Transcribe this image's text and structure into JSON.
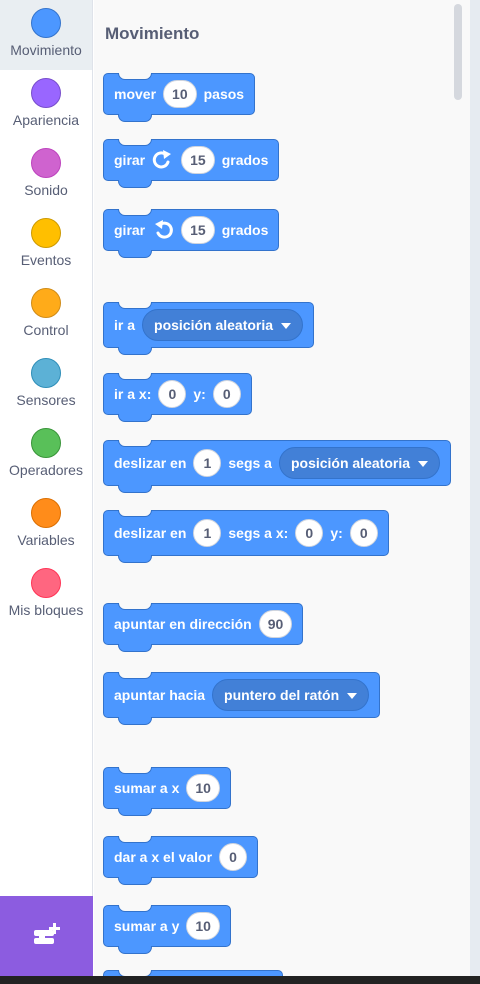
{
  "sidebar": {
    "items": [
      {
        "label": "Movimiento",
        "color": "#4c97ff",
        "border": "#3373cc"
      },
      {
        "label": "Apariencia",
        "color": "#9966ff",
        "border": "#774dcb"
      },
      {
        "label": "Sonido",
        "color": "#cf63cf",
        "border": "#bd42bd"
      },
      {
        "label": "Eventos",
        "color": "#ffbf00",
        "border": "#cc9900"
      },
      {
        "label": "Control",
        "color": "#ffab19",
        "border": "#cf8b17"
      },
      {
        "label": "Sensores",
        "color": "#5cb1d6",
        "border": "#2e8eb8"
      },
      {
        "label": "Operadores",
        "color": "#59c059",
        "border": "#389438"
      },
      {
        "label": "Variables",
        "color": "#ff8c1a",
        "border": "#db6e00"
      },
      {
        "label": "Mis bloques",
        "color": "#ff6680",
        "border": "#ff3355"
      }
    ],
    "selected": "Movimiento"
  },
  "flyout": {
    "title": "Movimiento",
    "blocks": {
      "move": {
        "text1": "mover",
        "value": "10",
        "text2": "pasos"
      },
      "turn_right": {
        "text1": "girar",
        "value": "15",
        "text2": "grados"
      },
      "turn_left": {
        "text1": "girar",
        "value": "15",
        "text2": "grados"
      },
      "goto": {
        "text1": "ir a",
        "menu": "posición aleatoria"
      },
      "goto_xy": {
        "text1": "ir a x:",
        "x": "0",
        "text2": "y:",
        "y": "0"
      },
      "glide_to": {
        "text1": "deslizar en",
        "secs": "1",
        "text2": "segs a",
        "menu": "posición aleatoria"
      },
      "glide_xy": {
        "text1": "deslizar en",
        "secs": "1",
        "text2": "segs a x:",
        "x": "0",
        "text3": "y:",
        "y": "0"
      },
      "point_dir": {
        "text1": "apuntar en dirección",
        "value": "90"
      },
      "point_towards": {
        "text1": "apuntar hacia",
        "menu": "puntero del ratón"
      },
      "change_x": {
        "text1": "sumar a x",
        "value": "10"
      },
      "set_x": {
        "text1": "dar a x el valor",
        "value": "0"
      },
      "change_y": {
        "text1": "sumar a y",
        "value": "10"
      }
    }
  },
  "extension_button": {
    "icon": "add-extension-icon"
  },
  "colors": {
    "motion": "#4c97ff",
    "motion_dark": "#3373cc",
    "extension": "#8c5ce0",
    "label": "#575e75"
  }
}
